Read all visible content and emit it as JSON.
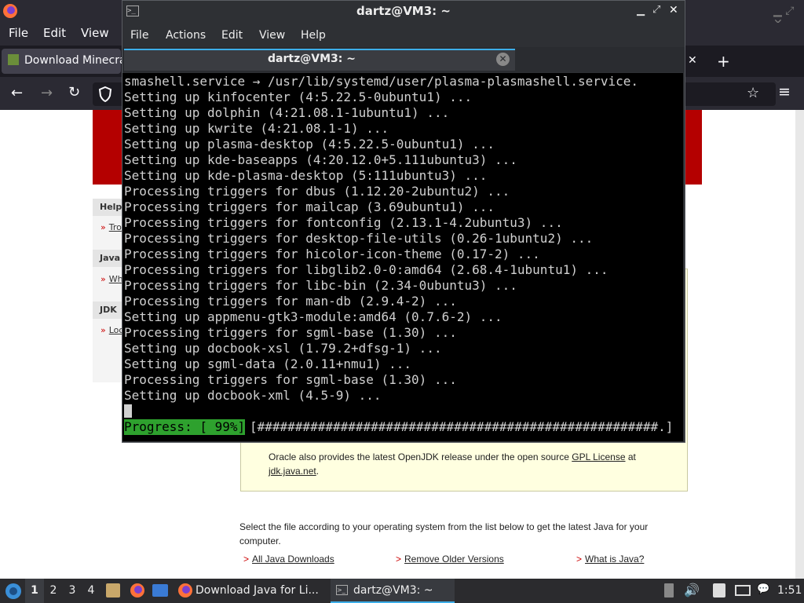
{
  "firefox": {
    "menu": [
      "File",
      "Edit",
      "View"
    ],
    "tab_title": "Download Minecra",
    "new_tab": "+",
    "tab_close": "✕"
  },
  "page": {
    "sidebar": {
      "help_head": "Help",
      "help_link": "Tro",
      "java_head": "Java",
      "java_link": "Wh",
      "jdk_head": "JDK",
      "jdk_link": "Loo"
    },
    "openjdk_text": "Oracle also provides the latest OpenJDK release under the open source",
    "gpl_link": "GPL License",
    "at_text": "at",
    "jdk_link": "jdk.java.net",
    "period": ".",
    "select_text_1": "Select the file according to your operating system from the list below to get the latest Java for your",
    "select_text_2": "computer.",
    "links": [
      "All Java Downloads",
      "Remove Older Versions",
      "What is Java?"
    ],
    "link_marker": ">"
  },
  "terminal": {
    "title": "dartz@VM3: ~",
    "menu": [
      "File",
      "Actions",
      "Edit",
      "View",
      "Help"
    ],
    "tab_title": "dartz@VM3: ~",
    "lines": [
      "smashell.service → /usr/lib/systemd/user/plasma-plasmashell.service.",
      "Setting up kinfocenter (4:5.22.5-0ubuntu1) ...",
      "Setting up dolphin (4:21.08.1-1ubuntu1) ...",
      "Setting up kwrite (4:21.08.1-1) ...",
      "Setting up plasma-desktop (4:5.22.5-0ubuntu1) ...",
      "Setting up kde-baseapps (4:20.12.0+5.111ubuntu3) ...",
      "Setting up kde-plasma-desktop (5:111ubuntu3) ...",
      "Processing triggers for dbus (1.12.20-2ubuntu2) ...",
      "Processing triggers for mailcap (3.69ubuntu1) ...",
      "Processing triggers for fontconfig (2.13.1-4.2ubuntu3) ...",
      "Processing triggers for desktop-file-utils (0.26-1ubuntu2) ...",
      "Processing triggers for hicolor-icon-theme (0.17-2) ...",
      "Processing triggers for libglib2.0-0:amd64 (2.68.4-1ubuntu1) ...",
      "Processing triggers for libc-bin (2.34-0ubuntu3) ...",
      "Processing triggers for man-db (2.9.4-2) ...",
      "Setting up appmenu-gtk3-module:amd64 (0.7.6-2) ...",
      "Processing triggers for sgml-base (1.30) ...",
      "Setting up docbook-xsl (1.79.2+dfsg-1) ...",
      "Setting up sgml-data (2.0.11+nmu1) ...",
      "Processing triggers for sgml-base (1.30) ...",
      "Setting up docbook-xml (4.5-9) ..."
    ],
    "progress_label": "Progress: [ 99%]",
    "progress_bar": "[#####################################################.]",
    "progress_percent": 99
  },
  "taskbar": {
    "workspaces": [
      "1",
      "2",
      "3",
      "4"
    ],
    "task_firefox": "Download Java for Li...",
    "task_terminal": "dartz@VM3: ~",
    "clock": "1:51"
  },
  "colors": {
    "accent": "#3daee9",
    "progress_green": "#2ea12e",
    "oracle_red": "#b40000"
  }
}
